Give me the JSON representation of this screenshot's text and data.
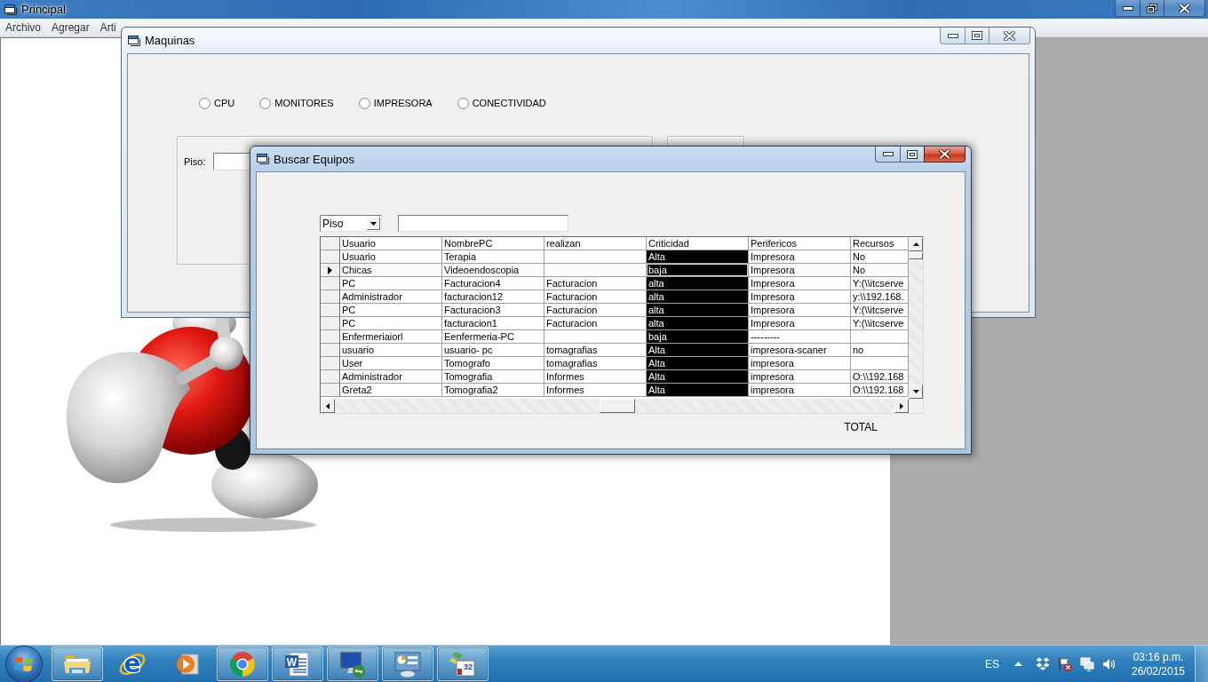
{
  "main_window": {
    "title": "Principal",
    "menu": [
      {
        "label": "Archivo"
      },
      {
        "label": "Agregar"
      },
      {
        "label": "Arti"
      }
    ]
  },
  "maquinas_window": {
    "title": "Maquinas",
    "options": [
      {
        "label": "CPU",
        "selected": false
      },
      {
        "label": "MONITORES",
        "selected": false
      },
      {
        "label": "IMPRESORA",
        "selected": false
      },
      {
        "label": "CONECTIVIDAD",
        "selected": false
      }
    ],
    "floor_label": "Piso:"
  },
  "buscar_window": {
    "title": "Buscar Equipos",
    "filter": {
      "value": "Piso"
    },
    "table": {
      "columns": [
        {
          "label": "Usuario",
          "kind": "text"
        },
        {
          "label": "NombrePC",
          "kind": "text"
        },
        {
          "label": "realizan",
          "kind": "text"
        },
        {
          "label": "Criticidad",
          "kind": "dark"
        },
        {
          "label": "Perifericos",
          "kind": "text"
        },
        {
          "label": "Recursos",
          "kind": "text"
        }
      ],
      "rows": [
        {
          "selected": false,
          "cells": {
            "usuario": "Usuario",
            "nombre_pc": "Terapia",
            "criticidad": "Alta",
            "perifericos": "Impresora",
            "recursos": "No"
          }
        },
        {
          "selected": true,
          "cells": {
            "usuario": "Chicas",
            "nombre_pc": "Videoendoscopia",
            "criticidad": "baja",
            "perifericos": "Impresora",
            "recursos": "No"
          }
        },
        {
          "selected": false,
          "cells": {
            "usuario": "PC",
            "nombre_pc": "Facturacion4",
            "realizan": "Facturacion",
            "criticidad": "alta",
            "perifericos": "Impresora",
            "recursos": "Y:(\\\\itcserve"
          }
        },
        {
          "selected": false,
          "cells": {
            "usuario": "Administrador",
            "nombre_pc": "facturacion12",
            "realizan": "Facturacion",
            "criticidad": "alta",
            "perifericos": "Impresora",
            "recursos": "y:\\\\192.168."
          }
        },
        {
          "selected": false,
          "cells": {
            "usuario": "PC",
            "nombre_pc": "Facturacion3",
            "realizan": "Facturacion",
            "criticidad": "alta",
            "perifericos": "Impresora",
            "recursos": "Y:(\\\\itcserve"
          }
        },
        {
          "selected": false,
          "cells": {
            "usuario": "PC",
            "nombre_pc": "facturacion1",
            "realizan": "Facturacion",
            "criticidad": "alta",
            "perifericos": "Impresora",
            "recursos": "Y:(\\\\itcserve"
          }
        },
        {
          "selected": false,
          "cells": {
            "usuario": "Enfermeriaiorl",
            "nombre_pc": "Eenfermeria-PC",
            "criticidad": "baja",
            "perifericos": "---------"
          }
        },
        {
          "selected": false,
          "cells": {
            "usuario": "usuario",
            "nombre_pc": "usuario- pc",
            "realizan": "tomagrafias",
            "criticidad": "Alta",
            "perifericos": "impresora-scaner",
            "recursos": "no"
          }
        },
        {
          "selected": false,
          "cells": {
            "usuario": "User",
            "nombre_pc": "Tomografo",
            "realizan": "tomagrafias",
            "criticidad": "Alta",
            "perifericos": "impresora"
          }
        },
        {
          "selected": false,
          "cells": {
            "usuario": "Administrador",
            "nombre_pc": "Tomografia",
            "realizan": "Informes",
            "criticidad": "Alta",
            "perifericos": "impresora",
            "recursos": "O:\\\\192.168"
          }
        },
        {
          "selected": false,
          "cells": {
            "usuario": "Greta2",
            "nombre_pc": "Tomografia2",
            "realizan": "Informes",
            "criticidad": "Alta",
            "perifericos": "impresora",
            "recursos": "O:\\\\192.168"
          }
        }
      ]
    },
    "total_label": "TOTAL"
  },
  "taskbar": {
    "apps": [
      {
        "kind": "folder",
        "running": true
      },
      {
        "kind": "ie",
        "running": false,
        "glyph": "e"
      },
      {
        "kind": "player",
        "running": false
      },
      {
        "kind": "chrome",
        "running": true
      },
      {
        "kind": "word",
        "running": true,
        "glyph": "W"
      },
      {
        "kind": "remote",
        "running": true
      },
      {
        "kind": "panel",
        "running": true
      },
      {
        "kind": "app32",
        "running": true,
        "glyph": "32"
      }
    ],
    "language": "ES",
    "time": "03:16 p.m.",
    "date": "26/02/2015"
  }
}
